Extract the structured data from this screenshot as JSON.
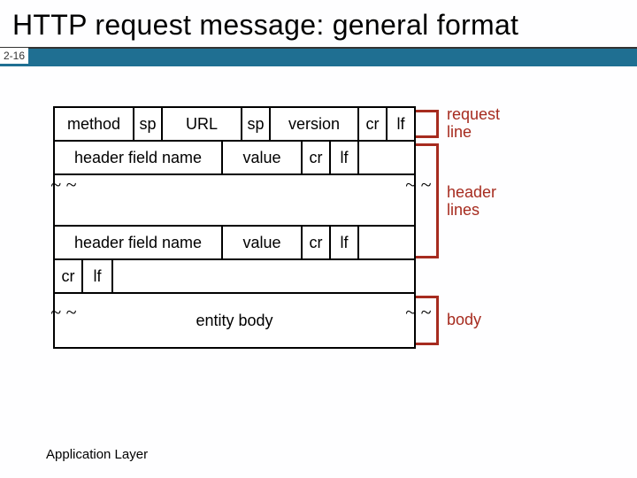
{
  "title": "HTTP request message: general format",
  "page_number": "2-16",
  "footer": "Application Layer",
  "rows": {
    "request_line": {
      "method": "method",
      "sp1": "sp",
      "url": "URL",
      "sp2": "sp",
      "version": "version",
      "cr": "cr",
      "lf": "lf"
    },
    "header1": {
      "name": "header field name",
      "value": "value",
      "cr": "cr",
      "lf": "lf"
    },
    "header2": {
      "name": "header field name",
      "value": "value",
      "cr": "cr",
      "lf": "lf"
    },
    "blank": {
      "cr": "cr",
      "lf": "lf"
    },
    "body": "entity body"
  },
  "annotations": {
    "request_line": "request\nline",
    "header_lines": "header\nlines",
    "body": "body"
  },
  "approx_glyph": "~\n~"
}
